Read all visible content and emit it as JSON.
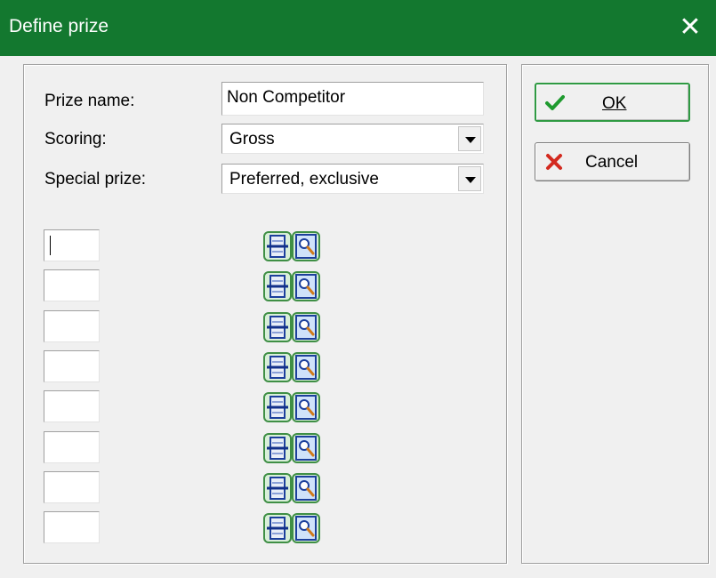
{
  "window": {
    "title": "Define prize",
    "close_glyph": "✕"
  },
  "form": {
    "prize_name_label": "Prize name:",
    "prize_name_value": "Non Competitor",
    "scoring_label": "Scoring:",
    "scoring_value": "Gross",
    "special_prize_label": "Special prize:",
    "special_prize_value": "Preferred, exclusive"
  },
  "rows": [
    {
      "value": ""
    },
    {
      "value": ""
    },
    {
      "value": ""
    },
    {
      "value": ""
    },
    {
      "value": ""
    },
    {
      "value": ""
    },
    {
      "value": ""
    },
    {
      "value": ""
    }
  ],
  "buttons": {
    "ok_label": "OK",
    "cancel_label": "Cancel"
  },
  "icons": {
    "row_list_icon": "list-icon",
    "row_search_icon": "magnifier-icon",
    "ok_icon": "checkmark-icon",
    "cancel_icon": "x-icon"
  },
  "colors": {
    "titlebar": "#13782f",
    "ok_check": "#1f9a2f",
    "cancel_x": "#d32a1f"
  }
}
